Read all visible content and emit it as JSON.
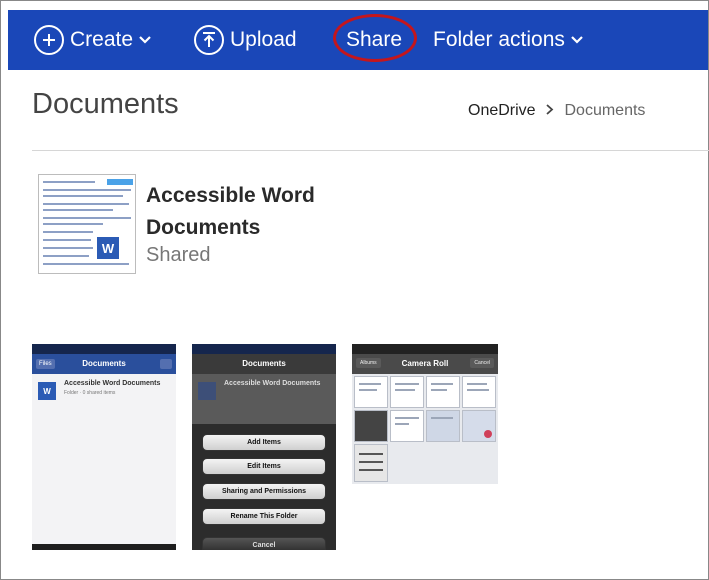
{
  "toolbar": {
    "create_label": "Create",
    "upload_label": "Upload",
    "share_label": "Share",
    "folder_actions_label": "Folder actions"
  },
  "header": {
    "title": "Documents",
    "breadcrumb": {
      "root": "OneDrive",
      "separator": ">",
      "current": "Documents"
    }
  },
  "folder": {
    "name": "Accessible Word Documents",
    "status": "Shared",
    "thumb_badge": "W"
  },
  "screenshots": {
    "list_view": {
      "nav_title": "Documents",
      "nav_back": "Files",
      "item_title": "Accessible Word Documents",
      "item_sub": "Folder · 0 shared items",
      "item_badge": "W"
    },
    "action_sheet": {
      "nav_title": "Documents",
      "item_title": "Accessible Word Documents",
      "buttons": [
        "Add Items",
        "Edit Items",
        "Sharing and Permissions",
        "Rename This Folder",
        "Cancel"
      ]
    },
    "camera_roll": {
      "nav_title": "Camera Roll",
      "left_btn": "Albums",
      "right_btn": "Cancel"
    }
  },
  "colors": {
    "command_bar": "#1a47b8",
    "share_highlight": "#c4161c"
  },
  "icons": [
    "plus-circle-icon",
    "upload-circle-icon",
    "chevron-down-icon"
  ]
}
